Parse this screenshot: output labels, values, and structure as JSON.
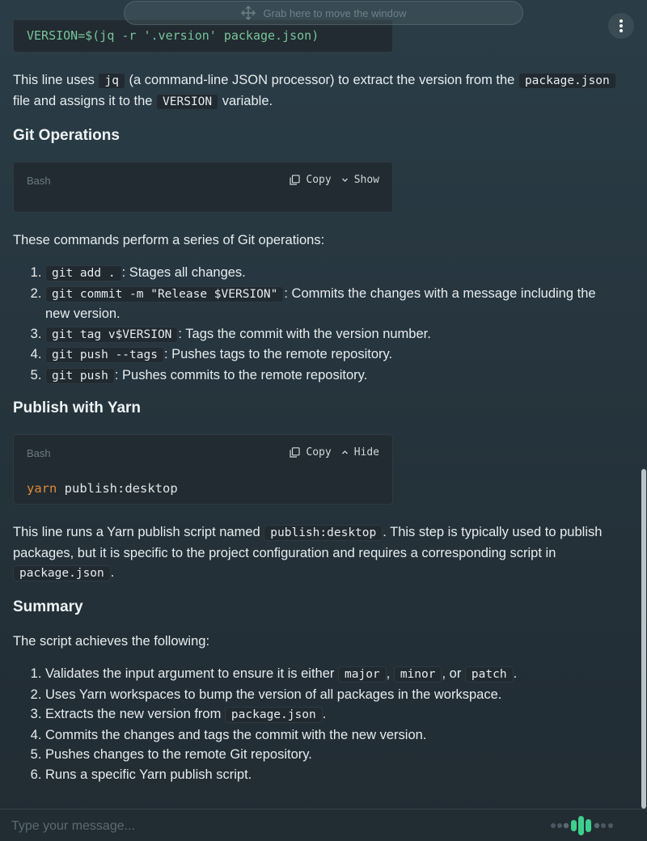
{
  "window": {
    "grab_label": "Grab here to move the window"
  },
  "top_code": {
    "p1": "VERSION=$(jq -r '.version' package.json)"
  },
  "jq_para": {
    "t1": "This line uses ",
    "c1": "jq",
    "t2": " (a command-line JSON processor) to extract the version from the ",
    "c2": "package.json",
    "t3": " file and assigns it to the ",
    "c3": "VERSION",
    "t4": " variable."
  },
  "git_section": {
    "heading": "Git Operations",
    "block": {
      "lang": "Bash",
      "copy_label": "Copy",
      "toggle_label": "Show"
    },
    "intro": "These commands perform a series of Git operations:",
    "items": [
      {
        "code": "git add .",
        "text": ": Stages all changes."
      },
      {
        "code": "git commit -m \"Release $VERSION\"",
        "text": ": Commits the changes with a message including the new version."
      },
      {
        "code": "git tag v$VERSION",
        "text": ": Tags the commit with the version number."
      },
      {
        "code": "git push --tags",
        "text": ": Pushes tags to the remote repository."
      },
      {
        "code": "git push",
        "text": ": Pushes commits to the remote repository."
      }
    ]
  },
  "yarn_section": {
    "heading": "Publish with Yarn",
    "block": {
      "lang": "Bash",
      "copy_label": "Copy",
      "toggle_label": "Hide",
      "keyword": "yarn",
      "args": "publish:desktop"
    },
    "para": {
      "t1": "This line runs a Yarn publish script named ",
      "c1": "publish:desktop",
      "t2": ". This step is typically used to publish packages, but it is specific to the project configuration and requires a corresponding script in ",
      "c2": "package.json",
      "t3": "."
    }
  },
  "summary": {
    "heading": "Summary",
    "intro": "The script achieves the following:",
    "item1": {
      "t1": "Validates the input argument to ensure it is either ",
      "c1": "major",
      "t2": ", ",
      "c2": "minor",
      "t3": ", or ",
      "c3": "patch",
      "t4": "."
    },
    "item2": "Uses Yarn workspaces to bump the version of all packages in the workspace.",
    "item3": {
      "t1": "Extracts the new version from ",
      "c1": "package.json",
      "t2": "."
    },
    "item4": "Commits the changes and tags the commit with the new version.",
    "item5": "Pushes changes to the remote Git repository.",
    "item6": "Runs a specific Yarn publish script."
  },
  "composer": {
    "placeholder": "Type your message..."
  },
  "colors": {
    "accent": "#3ecf8e",
    "code_keyword": "#e0893a",
    "code_green": "#79c49a"
  },
  "icons": [
    "move-icon",
    "kebab-menu-icon",
    "copy-icon",
    "chevron-down-icon",
    "chevron-up-icon",
    "voice-wave-icon"
  ]
}
